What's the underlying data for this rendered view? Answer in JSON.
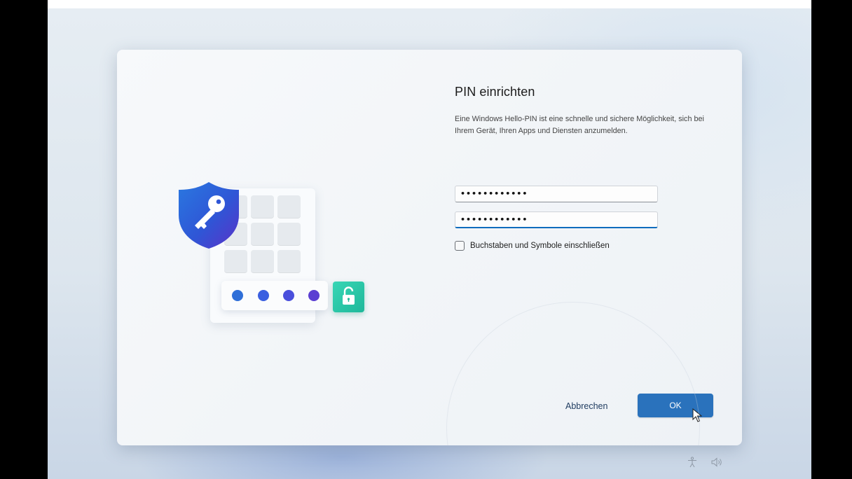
{
  "dialog": {
    "title": "PIN einrichten",
    "description": "Eine Windows Hello-PIN ist eine schnelle und sichere Möglichkeit, sich bei Ihrem Gerät, Ihren Apps und Diensten anzumelden.",
    "pin_field": {
      "value": "••••••••••••"
    },
    "confirm_field": {
      "value": "••••••••••••"
    },
    "checkbox": {
      "label": "Buchstaben und Symbole einschließen",
      "checked": false
    },
    "cancel_label": "Abbrechen",
    "ok_label": "OK"
  },
  "illustration": {
    "shield_icon": "key-shield-icon",
    "lock_icon": "unlocked-padlock-icon",
    "dot_colors": [
      "#2f6fd8",
      "#3a5fe0",
      "#4a4fdc",
      "#5b3fd2"
    ],
    "accent": "#2a72bc"
  },
  "tray": {
    "icons": [
      "accessibility-icon",
      "volume-icon"
    ]
  }
}
